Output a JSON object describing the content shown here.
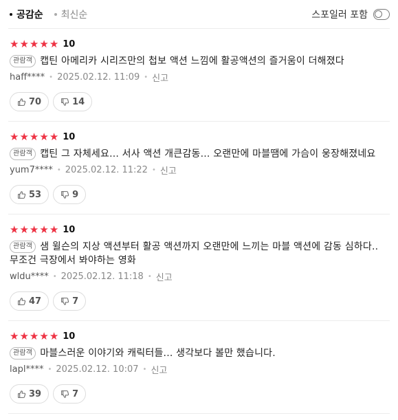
{
  "sort": {
    "options": [
      {
        "label": "공감순",
        "active": true
      },
      {
        "label": "최신순",
        "active": false
      }
    ]
  },
  "spoiler": {
    "label": "스포일러 포함",
    "enabled": false
  },
  "reviews": [
    {
      "stars": 5,
      "score": "10",
      "badge": "관람객",
      "text": "캡틴 아메리카 시리즈만의 첩보 액션 느낌에 활공액션의 즐거움이 더해졌다",
      "user": "haff****",
      "date": "2025.02.12. 11:09",
      "report": "신고",
      "likes": "70",
      "dislikes": "14"
    },
    {
      "stars": 5,
      "score": "10",
      "badge": "관람객",
      "text": "캡틴 그 자체세요... 서사 액션 개큰감동... 오랜만에 마블땜에 가슴이 웅장해졌네요",
      "user": "yum7****",
      "date": "2025.02.12. 11:22",
      "report": "신고",
      "likes": "53",
      "dislikes": "9"
    },
    {
      "stars": 5,
      "score": "10",
      "badge": "관람객",
      "text": "샘 윌슨의 지상 액션부터 활공 액션까지 오랜만에 느끼는 마블 액션에 감동 심하다.. 무조건 극장에서 봐야하는 영화",
      "user": "wldu****",
      "date": "2025.02.12. 11:18",
      "report": "신고",
      "likes": "47",
      "dislikes": "7"
    },
    {
      "stars": 5,
      "score": "10",
      "badge": "관람객",
      "text": "마블스러운 이야기와 캐릭터들... 생각보다 볼만 했습니다.",
      "user": "lapl****",
      "date": "2025.02.12. 10:07",
      "report": "신고",
      "likes": "39",
      "dislikes": "7"
    }
  ],
  "colors": {
    "star": "#ee3344",
    "border": "#ececec",
    "muted": "#888888"
  },
  "icons": {
    "like": "thumbs-up-icon",
    "dislike": "thumbs-down-icon",
    "star": "star-icon"
  }
}
